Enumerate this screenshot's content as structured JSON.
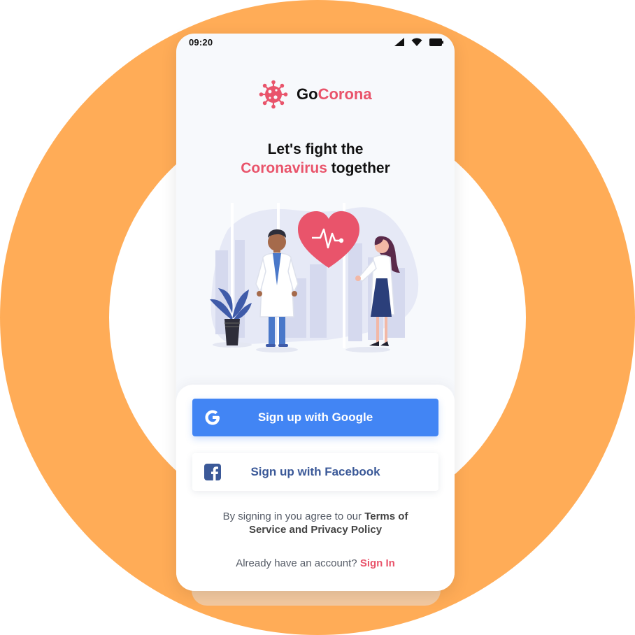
{
  "status_bar": {
    "time": "09:20",
    "icons": [
      "signal-icon",
      "wifi-icon",
      "battery-icon"
    ]
  },
  "app": {
    "name_part1": "Go",
    "name_part2": "Corona",
    "logo_icon": "virus-icon"
  },
  "headline": {
    "line1": "Let's fight the",
    "accent": "Coronavirus",
    "rest": "together"
  },
  "illustration": {
    "description_icon": "doctors-heart-illustration"
  },
  "actions": {
    "google_label": "Sign up with Google",
    "google_icon": "google-icon",
    "facebook_label": "Sign up with Facebook",
    "facebook_icon": "facebook-icon"
  },
  "terms": {
    "prefix": "By signing in you agree to our",
    "link": "Terms of Service and Privacy Policy"
  },
  "signin": {
    "prompt": "Already have an account?",
    "link": "Sign In"
  },
  "colors": {
    "accent": "#E9546B",
    "google_blue": "#4285F4",
    "facebook_blue": "#3B5998",
    "ring_orange": "#FFAC57"
  }
}
